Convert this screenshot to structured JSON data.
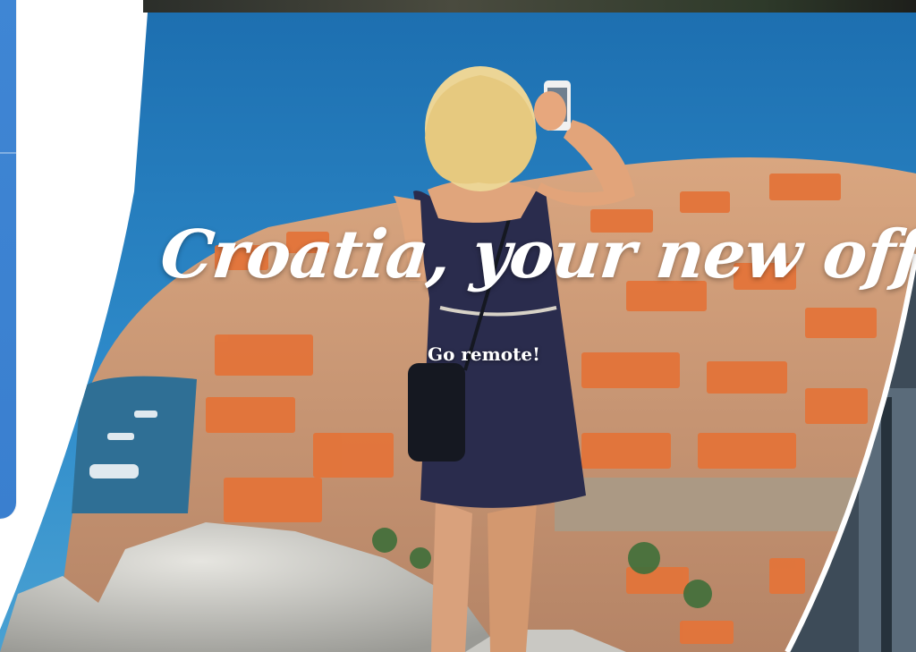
{
  "hero": {
    "headline": "Croatia, your new office!",
    "subheadline": "Go remote!"
  },
  "colors": {
    "accent_blue": "#3f86d4",
    "sea": "#2f86c4",
    "roof": "#e3743a",
    "text": "#ffffff"
  }
}
